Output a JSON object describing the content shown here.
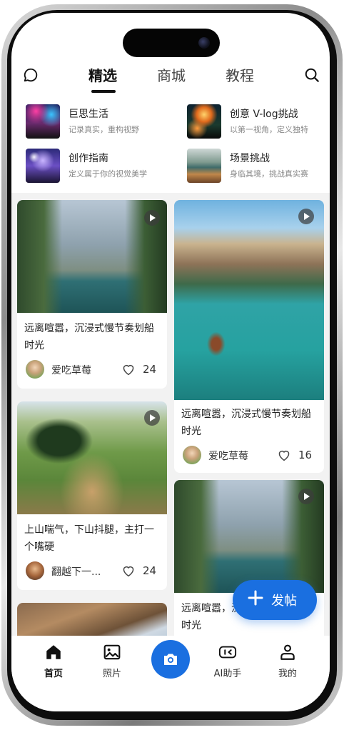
{
  "top_tabs": [
    {
      "label": "精选",
      "active": true
    },
    {
      "label": "商城",
      "active": false
    },
    {
      "label": "教程",
      "active": false
    }
  ],
  "icons": {
    "left": "chat-bubble-icon",
    "right": "search-icon"
  },
  "categories": [
    {
      "title": "巨思生活",
      "subtitle": "记录真实，重构视野"
    },
    {
      "title": "创意 V-log挑战",
      "subtitle": "以第一视角，定义独特"
    },
    {
      "title": "创作指南",
      "subtitle": "定义属于你的视觉美学"
    },
    {
      "title": "场景挑战",
      "subtitle": "身临其境，挑战真实赛"
    }
  ],
  "feed": {
    "left": [
      {
        "title": "远离喧嚣，沉浸式慢节奏划船时光",
        "author": "爱吃草莓",
        "likes": "24",
        "video": true
      },
      {
        "title": "上山喘气，下山抖腿，主打一个嘴硬",
        "author": "翻越下一...",
        "likes": "24",
        "video": true
      },
      {
        "title": "",
        "author": "",
        "likes": "",
        "video": false
      }
    ],
    "right": [
      {
        "title": "远离喧嚣，沉浸式慢节奏划船时光",
        "author": "爱吃草莓",
        "likes": "16",
        "video": true
      },
      {
        "title": "远离喧嚣，沉浸式慢节奏划船时光",
        "author": "",
        "likes": "",
        "video": true
      }
    ]
  },
  "post_button": {
    "label": "发帖"
  },
  "bottom_nav": [
    {
      "label": "首页",
      "icon": "home-icon",
      "active": true
    },
    {
      "label": "照片",
      "icon": "image-icon",
      "active": false
    },
    {
      "label": "",
      "icon": "camera-icon",
      "active": false
    },
    {
      "label": "AI助手",
      "icon": "ai-assistant-icon",
      "active": false
    },
    {
      "label": "我的",
      "icon": "profile-icon",
      "active": false
    }
  ],
  "colors": {
    "accent": "#1a6fe0",
    "feed_bg": "#f2f2f2",
    "text": "#222222",
    "muted": "#888888"
  }
}
